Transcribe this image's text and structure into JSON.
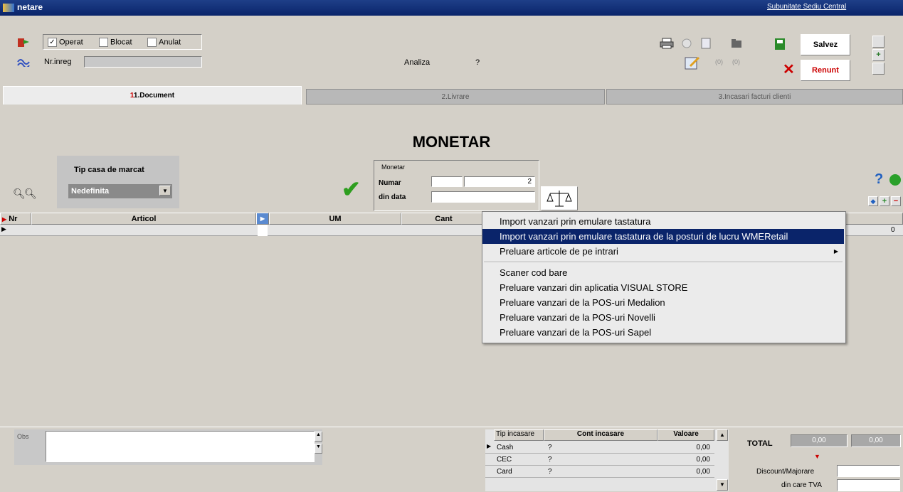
{
  "window": {
    "title": "netare",
    "location": "Subunitate Sediu Central"
  },
  "toolbar": {
    "operat": "Operat",
    "blocat": "Blocat",
    "anulat": "Anulat",
    "nr_inreg_label": "Nr.inreg",
    "nr_inreg_value": "",
    "analiza_label": "Analiza",
    "analiza_value": "?",
    "count1": "(0)",
    "count2": "(0)",
    "save_label": "Salvez",
    "cancel_label": "Renunt"
  },
  "tabs": [
    "1.Document",
    "2.Livrare",
    "3.Incasari facturi clienti"
  ],
  "page_title": "MONETAR",
  "tip_casa": {
    "label": "Tip casa de marcat",
    "value": "Nedefinita"
  },
  "monetar": {
    "group_label": "Monetar",
    "numar_label": "Numar",
    "numar_value": "2",
    "din_data_label": "din data",
    "din_data_value": ""
  },
  "grid": {
    "columns": [
      "Nr",
      "Articol",
      "UM",
      "Cant"
    ],
    "trailing_value": "0"
  },
  "context_menu": {
    "items": [
      "Import vanzari prin emulare tastatura",
      "Import vanzari prin emulare tastatura de la posturi de lucru WMERetail",
      "Preluare articole de pe intrari",
      "Scaner cod bare",
      "Preluare vanzari din aplicatia VISUAL STORE",
      "Preluare vanzari de la POS-uri Medalion",
      "Preluare vanzari de la POS-uri Novelli",
      "Preluare vanzari de la POS-uri Sapel"
    ]
  },
  "bottom": {
    "obs_label": "Obs",
    "payments_headers": [
      "Tip incasare",
      "Cont incasare",
      "Valoare"
    ],
    "payments": [
      {
        "type": "Cash",
        "account": "?",
        "value": "0,00"
      },
      {
        "type": "CEC",
        "account": "?",
        "value": "0,00"
      },
      {
        "type": "Card",
        "account": "?",
        "value": "0,00"
      }
    ],
    "total_label": "TOTAL",
    "total1": "0,00",
    "total2": "0,00",
    "discount_label": "Discount/Majorare",
    "tva_label": "din care TVA"
  },
  "colors": {
    "accent_red": "#cc0000",
    "highlight": "#0a246a",
    "check_green": "#2e9e1f"
  }
}
